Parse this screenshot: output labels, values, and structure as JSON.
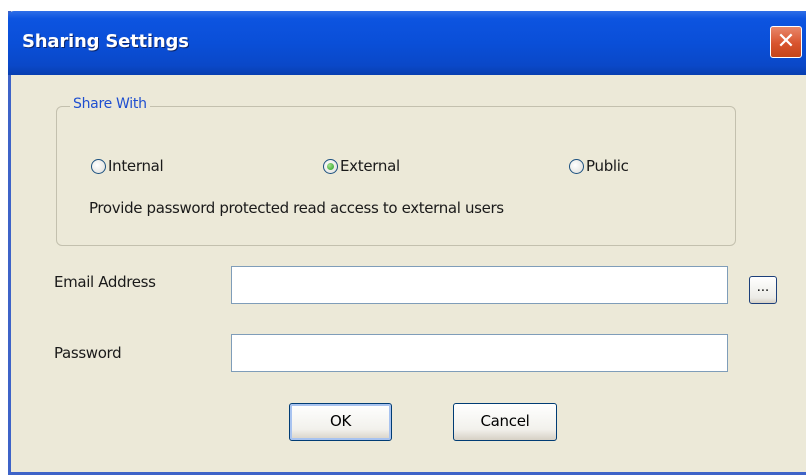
{
  "window": {
    "title": "Sharing Settings",
    "close_glyph": "✕",
    "close_icon": "close-icon"
  },
  "share_with": {
    "legend": "Share With",
    "options": [
      {
        "label": "Internal",
        "checked": false
      },
      {
        "label": "External",
        "checked": true
      },
      {
        "label": "Public",
        "checked": false
      }
    ],
    "description": "Provide password protected read access to external users"
  },
  "form": {
    "email_label": "Email Address",
    "email_value": "",
    "browse_label": "...",
    "password_label": "Password",
    "password_value": ""
  },
  "buttons": {
    "ok_label": "OK",
    "cancel_label": "Cancel"
  },
  "colors": {
    "titlebar": "#0a4fd8",
    "dialog_bg": "#ece9d8",
    "legend_text": "#1f4fd0",
    "close_button": "#d8542e"
  }
}
